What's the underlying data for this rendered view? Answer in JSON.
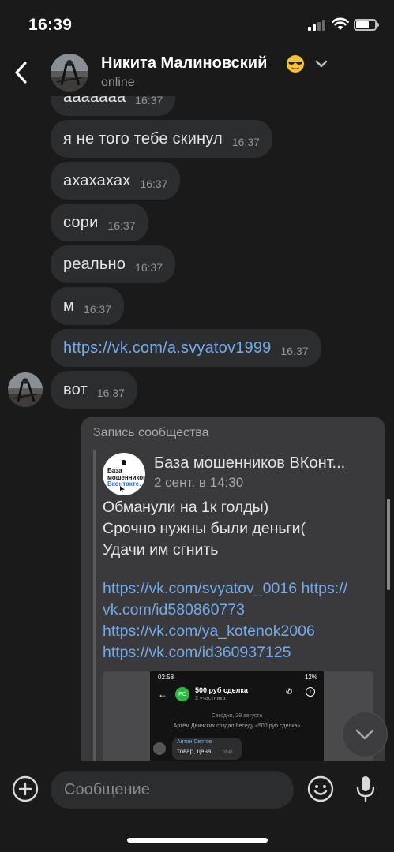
{
  "status_bar": {
    "time": "16:39"
  },
  "header": {
    "contact_name": "Никита Малиновский",
    "status": "online",
    "emoji_icon": "sunglasses-emoji-icon"
  },
  "messages": [
    {
      "text": "ааааааа",
      "time": "16:37",
      "is_link": false
    },
    {
      "text": "я не того тебе скинул",
      "time": "16:37",
      "is_link": false
    },
    {
      "text": "ахахахах",
      "time": "16:37",
      "is_link": false
    },
    {
      "text": "сори",
      "time": "16:37",
      "is_link": false
    },
    {
      "text": "реально",
      "time": "16:37",
      "is_link": false
    },
    {
      "text": "м",
      "time": "16:37",
      "is_link": false
    },
    {
      "text": "https://vk.com/a.svyatov1999",
      "time": "16:37",
      "is_link": true
    },
    {
      "text": "вот",
      "time": "16:37",
      "is_link": false
    }
  ],
  "repost": {
    "header": "Запись сообщества",
    "group_name": "База мошенников ВКонт...",
    "group_logo": {
      "line1": "База",
      "line2": "мошенников",
      "line3": "Вконтакте."
    },
    "date": "2 сент. в 14:30",
    "text_lines": [
      "Обманули на 1к голды)",
      "Срочно нужны были деньги(",
      "Удачи им сгнить"
    ],
    "link_lines": [
      "https://vk.com/svyatov_0016 https://",
      "vk.com/id580860773",
      "https://vk.com/ya_kotenok2006",
      "https://vk.com/id360937125"
    ],
    "screenshot": {
      "time": "02:58",
      "battery": "12%",
      "avatar": "PC",
      "title": "500 руб сделка",
      "subtitle": "3 участника",
      "date_sep": "Сегодня, 29 августа",
      "system_msg": "Артём Двинских создал беседу «500 руб сделка»",
      "sender": "Антон Святов",
      "message": "товар, цена",
      "msg_time": "02:43"
    }
  },
  "composer": {
    "placeholder": "Сообщение"
  },
  "colors": {
    "background": "#1a1a1b",
    "bubble": "#2c2d2e",
    "link": "#71aaeb",
    "muted": "#939393"
  }
}
